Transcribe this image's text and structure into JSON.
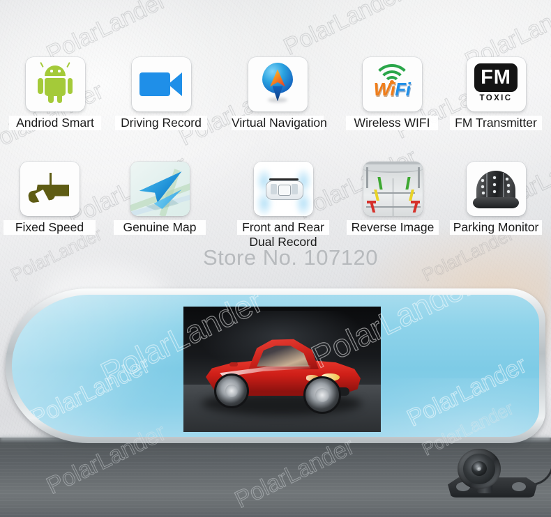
{
  "watermark": {
    "brand": "PolarLander",
    "store_no": "Store No. 107120"
  },
  "features": {
    "row1": [
      {
        "label": "Andriod Smart",
        "icon": "android-robot-icon"
      },
      {
        "label": "Driving Record",
        "icon": "camcorder-icon"
      },
      {
        "label": "Virtual Navigation",
        "icon": "map-pin-compass-icon"
      },
      {
        "label": "Wireless WIFI",
        "icon": "wifi-icon"
      },
      {
        "label": "FM Transmitter",
        "icon": "fm-transmitter-icon"
      }
    ],
    "row2": [
      {
        "label": "Fixed Speed",
        "label2": "",
        "icon": "speed-camera-icon"
      },
      {
        "label": "Genuine Map",
        "label2": "",
        "icon": "paper-plane-map-icon"
      },
      {
        "label": "Front and Rear",
        "label2": "Dual Record",
        "icon": "top-down-car-icon"
      },
      {
        "label": "Reverse Image",
        "label2": "",
        "icon": "reverse-guideline-icon"
      },
      {
        "label": "Parking Monitor",
        "label2": "",
        "icon": "dome-camera-icon"
      }
    ]
  },
  "icon_text": {
    "fm_main": "FM",
    "fm_sub": "TOXIC",
    "wifi_wi": "Wi",
    "wifi_fi": "Fi"
  },
  "product": {
    "mirror_name": "rearview-mirror-dashcam",
    "screen_content": "red-ferrari-sports-car",
    "rear_camera_name": "reverse-backup-camera"
  },
  "colors": {
    "android_green": "#a4ca39",
    "camcorder_blue": "#1f8fe8",
    "wifi_green": "#2aa64a",
    "wifi_orange": "#f07d1a",
    "wifi_blue": "#1f8fe8",
    "fm_black": "#141414",
    "speed_olive": "#5e5c14",
    "mirror_glass": "#8ed3ea",
    "car_red": "#cf1f18",
    "floor_gray": "#6a6f72"
  }
}
